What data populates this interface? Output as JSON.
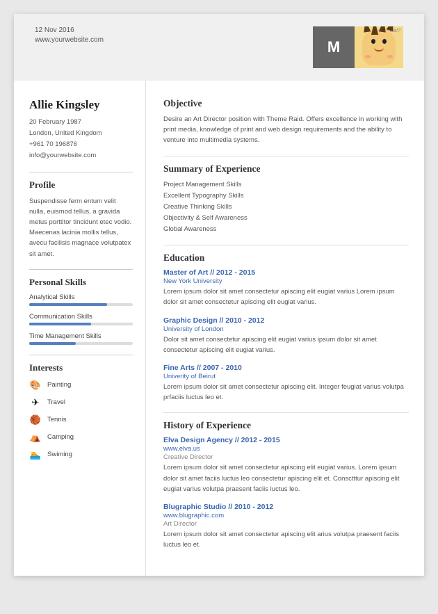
{
  "header": {
    "date": "12 Nov 2016",
    "website": "www.yourwebsite.com",
    "initial": "M",
    "cartoon_label": "whoa!?"
  },
  "left": {
    "name": "Allie Kingsley",
    "contact": {
      "dob": "20 February 1987",
      "location": "London, United Kingdom",
      "phone": "+961 70 196876",
      "email": "info@yourwebsite.com"
    },
    "profile_title": "Profile",
    "profile_text": "Suspendisse ferm entum velit nulla, euismod tellus, a gravida metus porttitor tincidunt etec vodio. Maecenas lacinia mollis tellus, avecu facilisis magnace volutpatex sit amet.",
    "skills_title": "Personal Skills",
    "skills": [
      {
        "label": "Analytical Skills",
        "percent": 75
      },
      {
        "label": "Communication Skills",
        "percent": 60
      },
      {
        "label": "Time Management Skills",
        "percent": 45
      }
    ],
    "interests_title": "Interests",
    "interests": [
      {
        "icon": "🎨",
        "label": "Painting"
      },
      {
        "icon": "✈",
        "label": "Travel"
      },
      {
        "icon": "🏀",
        "label": "Tennis"
      },
      {
        "icon": "⛺",
        "label": "Camping"
      },
      {
        "icon": "🏊",
        "label": "Swiming"
      }
    ]
  },
  "right": {
    "objective_title": "Objective",
    "objective_text": "Desire an Art Director position with Theme Raid. Offers excellence in working with print media, knowledge of print and web design requirements and the ability to venture into multimedia systems.",
    "summary_title": "Summary of Experience",
    "summary_items": [
      "Project Management Skills",
      "Excellent Typography Skills",
      "Creative Thinking Skills",
      "Objectivity & Self Awareness",
      "Global Awareness"
    ],
    "education_title": "Education",
    "education": [
      {
        "title": "Master of Art // 2012 - 2015",
        "school": "New York University",
        "desc": "Lorem ipsum dolor sit amet consectetur apiscing elit eugiat varius Lorem ipsum dolor sit amet consectetur apiscing elit eugiat varius."
      },
      {
        "title": "Graphic Design // 2010 - 2012",
        "school": "University of London",
        "desc": "Dolor sit amet consectetur apiscing elit eugiat varius  ipsum dolor sit amet consectetur apiscing elit eugiat varius."
      },
      {
        "title": "Fine Arts // 2007 - 2010",
        "school": "Univerity of Beirut",
        "desc": "Lorem ipsum dolor sit amet consectetur apiscing elit. Integer feugiat varius volutpa prfaciis luctus leo et."
      }
    ],
    "experience_title": "History of Experience",
    "experience": [
      {
        "title": "Elva Design Agency // 2012 - 2015",
        "url": "www.elva.us",
        "role": "Creative Director",
        "desc": "Lorem ipsum dolor sit amet consectetur apiscing elit eugiat varius. Lorem ipsum dolor sit amet faciis luctus leo consectetur apiscing elit et. Consctttur apiscing elit eugiat varius volutpa praesent faciis luctus leo."
      },
      {
        "title": "Blugraphic Studio // 2010 - 2012",
        "url": "www.blugraphic.com",
        "role": "Art Director",
        "desc": "Lorem ipsum dolor sit amet consectetur apiscing elit arius volutpa praesent faciis luctus leo et."
      }
    ]
  }
}
